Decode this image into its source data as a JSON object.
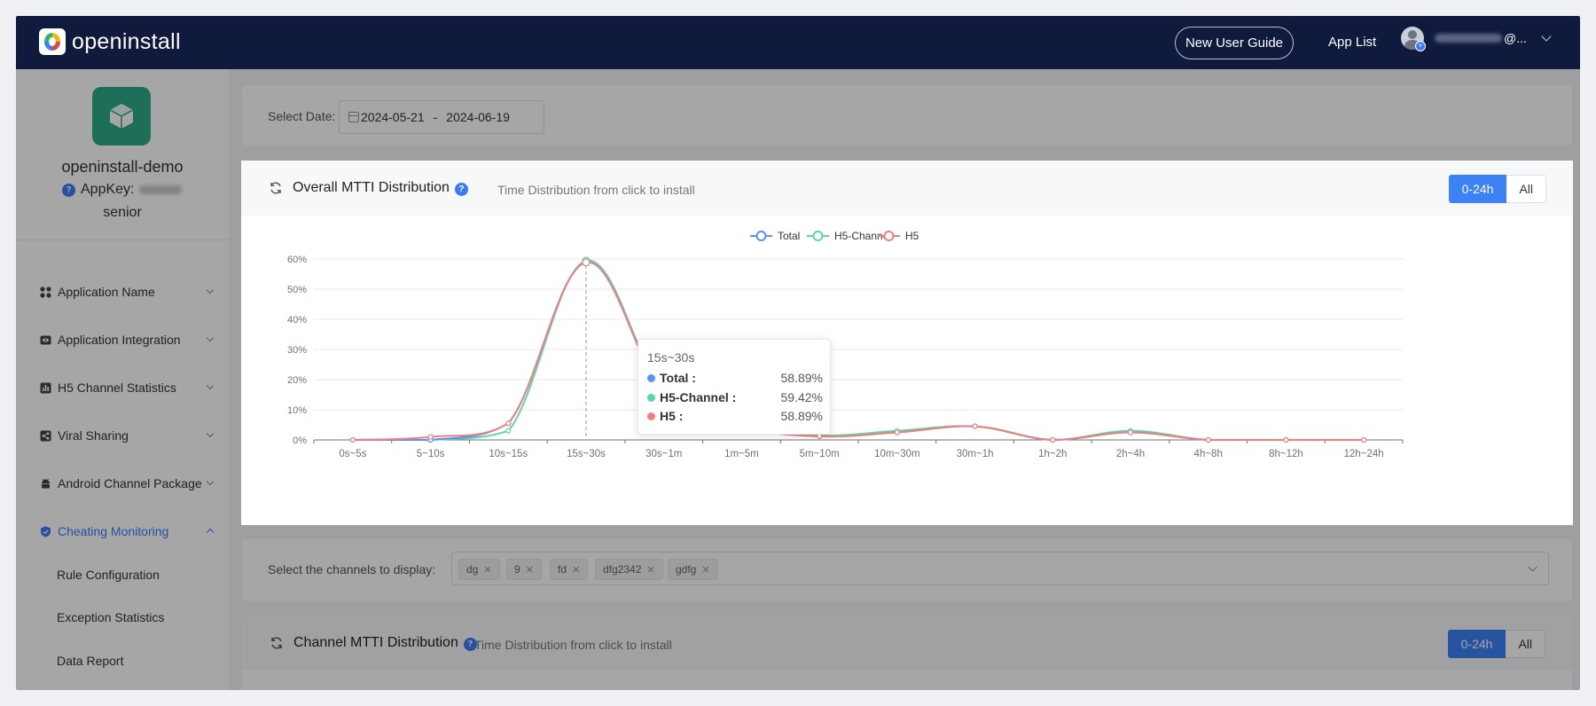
{
  "header": {
    "brand": "openinstall",
    "new_user_guide": "New User Guide",
    "app_list": "App List",
    "user_suffix": "@..."
  },
  "sidebar": {
    "app_name": "openinstall-demo",
    "appkey_label": "AppKey:",
    "level": "senior",
    "menu": [
      {
        "label": "Application Name",
        "icon": "grid-icon"
      },
      {
        "label": "Application Integration",
        "icon": "eye-icon"
      },
      {
        "label": "H5 Channel Statistics",
        "icon": "bar-chart-icon"
      },
      {
        "label": "Viral Sharing",
        "icon": "share-icon"
      },
      {
        "label": "Android Channel Package",
        "icon": "android-icon"
      },
      {
        "label": "Cheating Monitoring",
        "icon": "shield-icon"
      }
    ],
    "submenu": [
      "Rule Configuration",
      "Exception Statistics",
      "Data Report"
    ],
    "accent": "#3b7bf6"
  },
  "filters": {
    "select_date_label": "Select Date:",
    "date_start": "2024-05-21",
    "date_sep": "-",
    "date_end": "2024-06-19"
  },
  "overall": {
    "title": "Overall MTTI Distribution",
    "subtitle": "Time Distribution from click to install",
    "range_buttons": [
      "0-24h",
      "All"
    ],
    "selected_range": "0-24h"
  },
  "chart_data": {
    "type": "line",
    "categories": [
      "0s~5s",
      "5~10s",
      "10s~15s",
      "15s~30s",
      "30s~1m",
      "1m~5m",
      "5m~10m",
      "10m~30m",
      "30m~1h",
      "1h~2h",
      "2h~4h",
      "4h~8h",
      "8h~12h",
      "12h~24h"
    ],
    "series": [
      {
        "name": "Total",
        "color": "#5b8ff9",
        "values": [
          0,
          0,
          5.5,
          58.89,
          15.5,
          4.5,
          1.2,
          2.5,
          4.5,
          0,
          2.5,
          0,
          0,
          0
        ]
      },
      {
        "name": "H5-Channel",
        "color": "#5ad8a6",
        "values": [
          0,
          0,
          3.0,
          59.42,
          16.0,
          4.5,
          1.5,
          3.0,
          4.5,
          0,
          3.0,
          0,
          0,
          0
        ]
      },
      {
        "name": "H5",
        "color": "#f08080",
        "values": [
          0,
          1.0,
          5.5,
          58.89,
          15.5,
          4.5,
          1.2,
          2.5,
          4.5,
          0,
          2.5,
          0,
          0,
          0
        ]
      }
    ],
    "y_ticks": [
      "0%",
      "10%",
      "20%",
      "30%",
      "40%",
      "50%",
      "60%"
    ],
    "ylim": [
      0,
      60
    ],
    "legend_position": "top-center",
    "grid": true
  },
  "tooltip": {
    "category": "15s~30s",
    "rows": [
      {
        "name": "Total :",
        "value": "58.89%",
        "color": "#5b8ff9"
      },
      {
        "name": "H5-Channel :",
        "value": "59.42%",
        "color": "#5ad8a6"
      },
      {
        "name": "H5 :",
        "value": "58.89%",
        "color": "#f08080"
      }
    ]
  },
  "channels": {
    "label": "Select the channels to display:",
    "tags": [
      "dg",
      "9",
      "fd",
      "dfg2342",
      "gdfg"
    ]
  },
  "channel_chart": {
    "title": "Channel MTTI Distribution",
    "subtitle": "Time Distribution from click to install",
    "range_buttons": [
      "0-24h",
      "All"
    ]
  }
}
